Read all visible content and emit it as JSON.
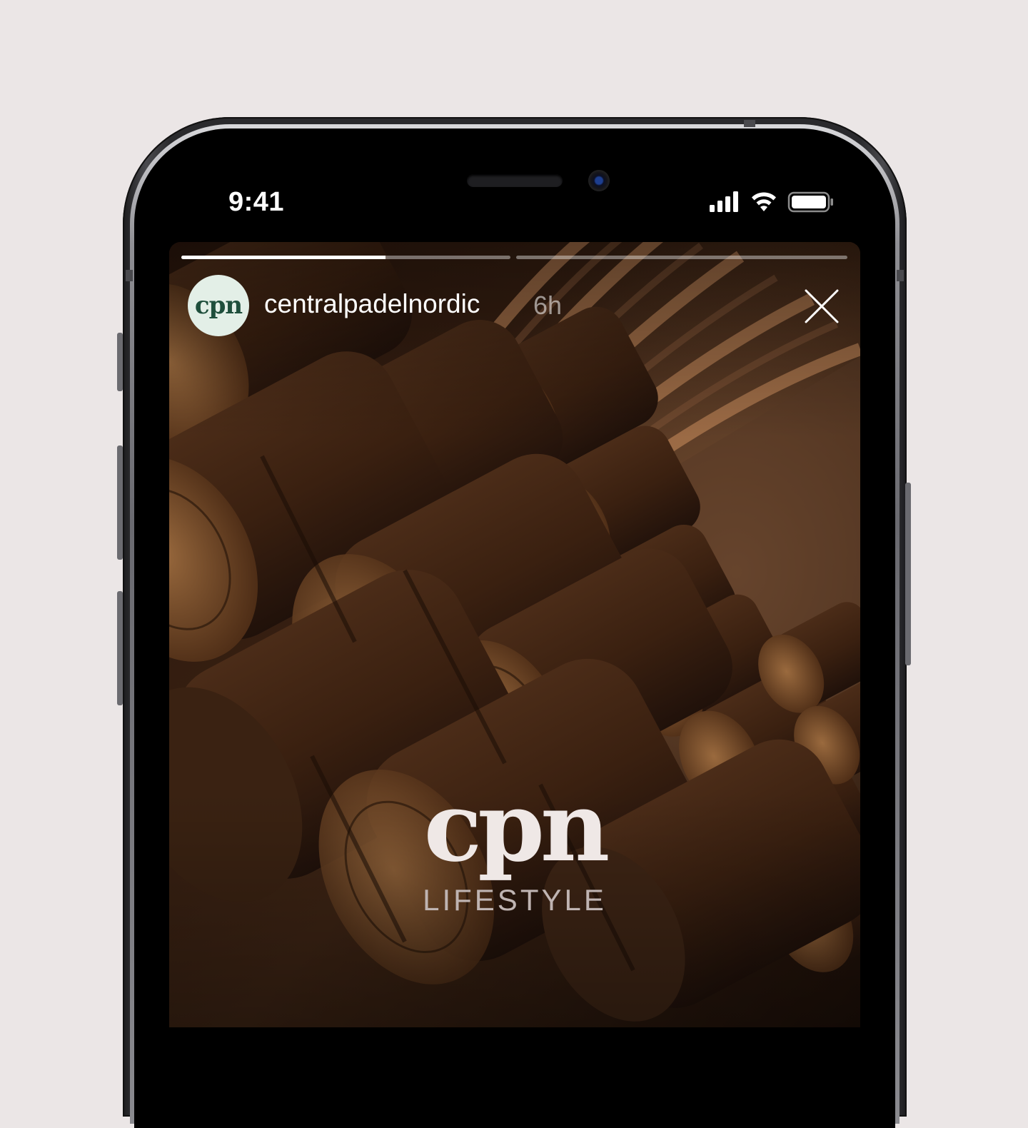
{
  "status_bar": {
    "time": "9:41",
    "signal_icon": "cellular-signal-icon",
    "wifi_icon": "wifi-icon",
    "battery_icon": "battery-icon"
  },
  "story": {
    "progress": [
      {
        "fraction": 0.62
      },
      {
        "fraction": 0.0
      }
    ],
    "avatar_text": "cpn",
    "username": "centralpadelnordic",
    "age": "6h",
    "close_icon": "close-icon",
    "logo": {
      "word": "cpn",
      "subtitle": "LIFESTYLE"
    }
  },
  "colors": {
    "background": "#ebe6e6",
    "avatar_bg": "#e3efe7",
    "avatar_text": "#1f4f3c",
    "logo": "#efe8e6"
  }
}
